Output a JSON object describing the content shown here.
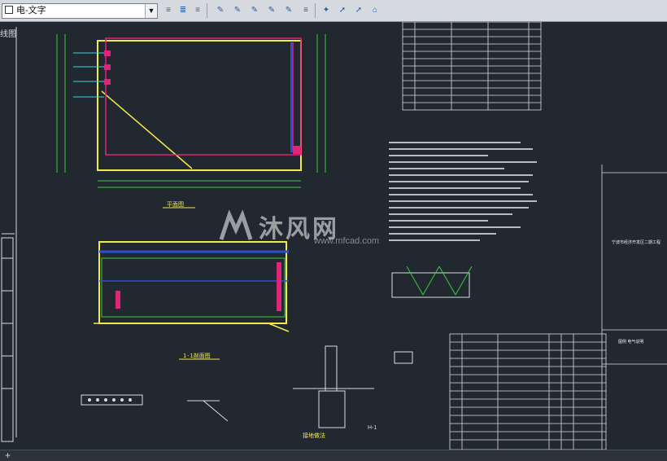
{
  "toolbar": {
    "layer_name": "电-文字",
    "layer_dropdown_icon": "chevron-down-icon",
    "buttons": [
      "layer-properties-icon",
      "layer-state-icon",
      "layer-previous-icon",
      "make-current-icon",
      "match-layer-icon",
      "layer-isolate-icon",
      "layer-unisolate-icon",
      "layer-freeze-icon",
      "layer-off-icon",
      "layer-lock-icon",
      "layer-unlock-icon",
      "layer-walk-icon"
    ]
  },
  "view": {
    "label": "线图"
  },
  "drawing": {
    "plan_title": "平面图",
    "section_title": "1-1剖面图",
    "node_title": "接地做法",
    "section_h": "H-1",
    "watermark_text": "沐风网",
    "watermark_url": "www.mfcad.com",
    "project_name": "宁波市经济开发区二期工程",
    "stamp_label": "图例 电气说明",
    "colors": {
      "background": "#212830",
      "wall": "#f2e94a",
      "dim": "#3ec93e",
      "cable": "#e0247a",
      "grid": "#2d4cd8",
      "text": "#ffffff",
      "cyan": "#36d6e0"
    }
  },
  "statusbar": {
    "plus_icon": "plus-icon"
  }
}
